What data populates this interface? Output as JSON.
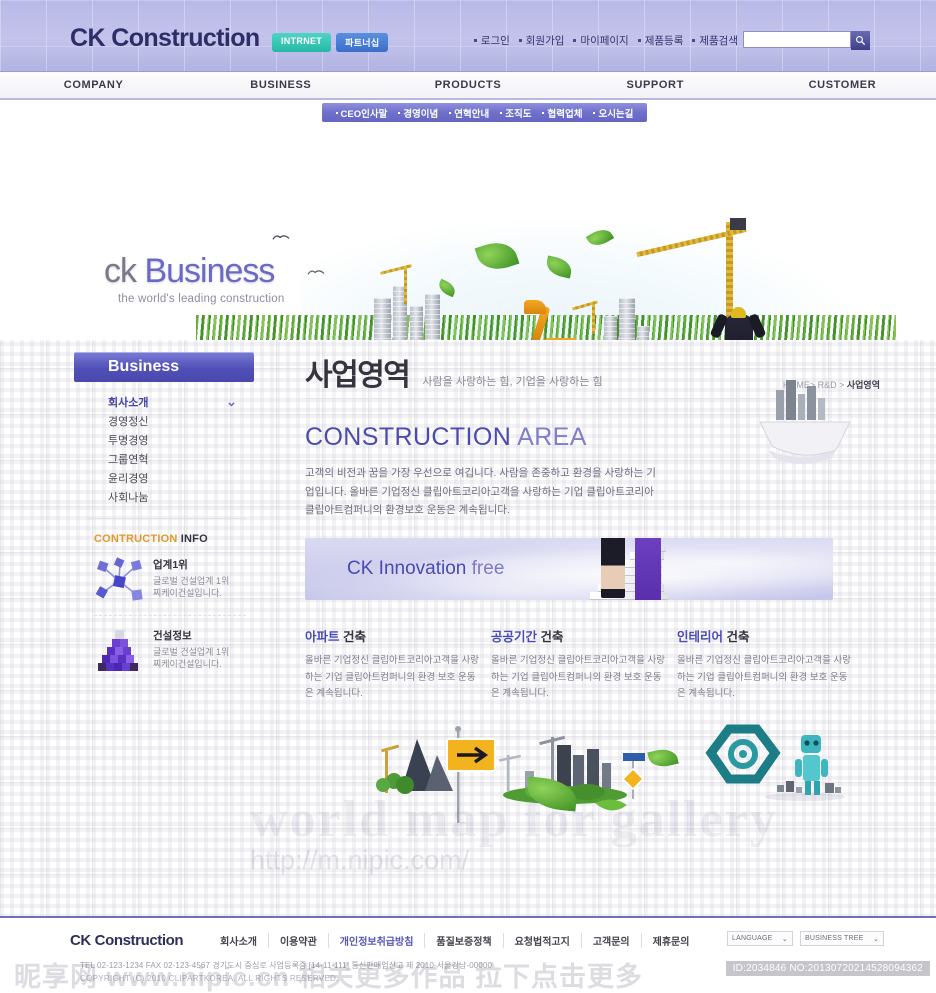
{
  "header": {
    "logo": "CK Construction",
    "badges": [
      {
        "label": "INTRNET",
        "color": "#27b9a6"
      },
      {
        "label": "파트너십",
        "color": "#3c6ec9"
      }
    ],
    "top_links": [
      "로그인",
      "회원가입",
      "마이페이지",
      "제품등록",
      "제품검색"
    ],
    "search_placeholder": "",
    "search_value": "",
    "search_icon": "search-icon"
  },
  "mainnav": {
    "items": [
      "COMPANY",
      "BUSINESS",
      "PRODUCTS",
      "SUPPORT",
      "CUSTOMER"
    ]
  },
  "subnav": {
    "items": [
      "CEO인사말",
      "경영이념",
      "연혁안내",
      "조직도",
      "협력업체",
      "오시는길"
    ]
  },
  "hero": {
    "title_prefix": "ck",
    "title_main": "Business",
    "tagline": "the world's leading construction"
  },
  "sidebar": {
    "heading": "Business",
    "items": [
      {
        "label": "회사소개",
        "active": true
      },
      {
        "label": "경영정신",
        "active": false
      },
      {
        "label": "투명경영",
        "active": false
      },
      {
        "label": "그룹연혁",
        "active": false
      },
      {
        "label": "윤리경영",
        "active": false
      },
      {
        "label": "사회나눔",
        "active": false
      }
    ],
    "info_title_orange": "CONTRUCTION",
    "info_title_dark": "INFO",
    "info_items": [
      {
        "title": "업계1위",
        "desc": "글로벌 건설업계 1위\n찌케이건설입니다.",
        "icon": "network-nodes-icon"
      },
      {
        "title": "건설정보",
        "desc": "글로벌 건설업계 1위\n찌케이건설입니다.",
        "icon": "blocks-pyramid-icon"
      }
    ]
  },
  "content": {
    "title": "사업영역",
    "subtitle": "사람을 사랑하는 힘, 기업을 사랑하는 힘",
    "breadcrumb_path": "HOME> R&D >",
    "breadcrumb_current": "사업영역",
    "area_head_bold": "CONSTRUCTION",
    "area_head_light": "AREA",
    "area_body": "고객의 비전과 꿈을 가장 우선으로 여깁니다. 사람을 존중하고 환경을 사랑하는 기업입니다. 올바른 기업정신 클립아트코리아고객을 사랑하는 기업 클립아트코리아 클립아트컴퍼니의 환경보호 운동은 계속됩니다.",
    "banner_text_main": "CK Innovation",
    "banner_text_light": "free",
    "columns": [
      {
        "title_accent": "아파트",
        "title_rest": "건축",
        "body": "올바른 기업정신 클립아트코리아고객을 사랑하는 기업 클립아트컴퍼니의 환경 보호 운동은 계속됩니다."
      },
      {
        "title_accent": "공공기간",
        "title_rest": "건축",
        "body": "올바른 기업정신 클립아트코리아고객을 사랑하는 기업 클립아트컴퍼니의 환경 보호 운동은 계속됩니다."
      },
      {
        "title_accent": "인테리어",
        "title_rest": "건축",
        "body": "올바른 기업정신 클립아트코리아고객을 사랑하는 기업 클립아트컴퍼니의 환경 보호 운동은 계속됩니다."
      }
    ]
  },
  "footer": {
    "logo": "CK Construction",
    "links": [
      {
        "label": "회사소개",
        "highlight": false
      },
      {
        "label": "이용약관",
        "highlight": false
      },
      {
        "label": "개인정보취급방침",
        "highlight": true
      },
      {
        "label": "품질보증정책",
        "highlight": false
      },
      {
        "label": "요청법적고지",
        "highlight": false
      },
      {
        "label": "고객문의",
        "highlight": false
      },
      {
        "label": "제휴문의",
        "highlight": false
      }
    ],
    "selects": [
      {
        "label": "LANGUAGE",
        "chevron": "chevron-down-icon"
      },
      {
        "label": "BUSINESS TREE",
        "chevron": "chevron-down-icon"
      }
    ],
    "address": "TEL 02-123-1234  FAX 02-123-4567  경기도시 중심로 사업등록증 [14-11-111] 통신판매업신고 제 2010-서울강남-00000",
    "copyright": "COPYRIGHT (C) 2010 CLIPARTKOREA. ALL RIGHTS RESERVED."
  },
  "watermark": {
    "diag_text": "world map for gallery",
    "url_text": "http://m.nipic.com/",
    "bottom_cn": "昵享网 www.nipic.cn  相关更多作品  拉下点击更多",
    "id_text": "ID:2034846 NO:20130720214528094362"
  },
  "colors": {
    "brand_purple": "#4a4ab0",
    "header_bg": "#c3c3ec",
    "accent_orange": "#e09a2c",
    "nav_blue": "#6f6fcc"
  }
}
